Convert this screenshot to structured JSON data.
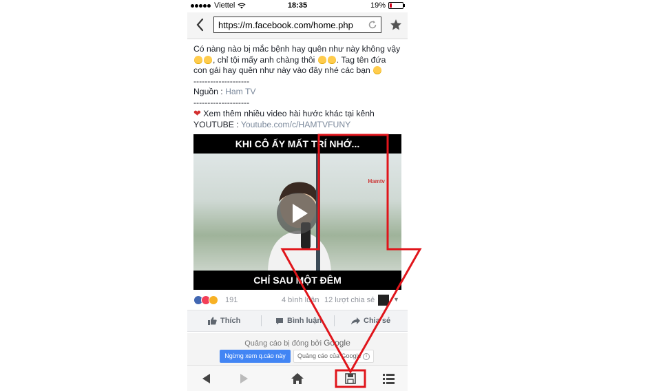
{
  "status_bar": {
    "carrier": "Viettel",
    "time": "18:35",
    "battery": "19%"
  },
  "browser": {
    "url": "https://m.facebook.com/home.php"
  },
  "post": {
    "line1": "Có nàng nào bị mắc bệnh hay quên như này không vậy",
    "line2": ", chỉ tội mấy anh chàng thôi",
    "line3": ". Tag tên đứa",
    "line4": "con gái hay quên như này vào đây nhé các bạn",
    "divider": "--------------------",
    "source_label": "Nguồn :",
    "source_value": "Ham TV",
    "more_text": "Xem thêm nhiều video hài hước khác tại kênh",
    "youtube_label": "YOUTUBE :",
    "youtube_link": "Youtube.com/c/HAMTVFUNY"
  },
  "video": {
    "top_caption": "KHI CÔ ẤY MẤT TRÍ NHỚ...",
    "bottom_caption": "CHỈ SAU MỘT ĐÊM",
    "watermark": "Hamtv"
  },
  "stats": {
    "reactions": "191",
    "comments": "4 bình luận",
    "shares": "12 lượt chia sẻ"
  },
  "actions": {
    "like": "Thích",
    "comment": "Bình luận",
    "share": "Chia sẻ"
  },
  "ad": {
    "blocked_by": "Quảng cáo bị đóng bởi",
    "google": "Google",
    "stop_button": "Ngừng xem q.cáo này",
    "google_ads_button": "Quảng cáo của Google"
  },
  "colors": {
    "annotation": "#e0151b",
    "facebook_blue": "#4267b2",
    "ad_blue": "#4285f4"
  }
}
